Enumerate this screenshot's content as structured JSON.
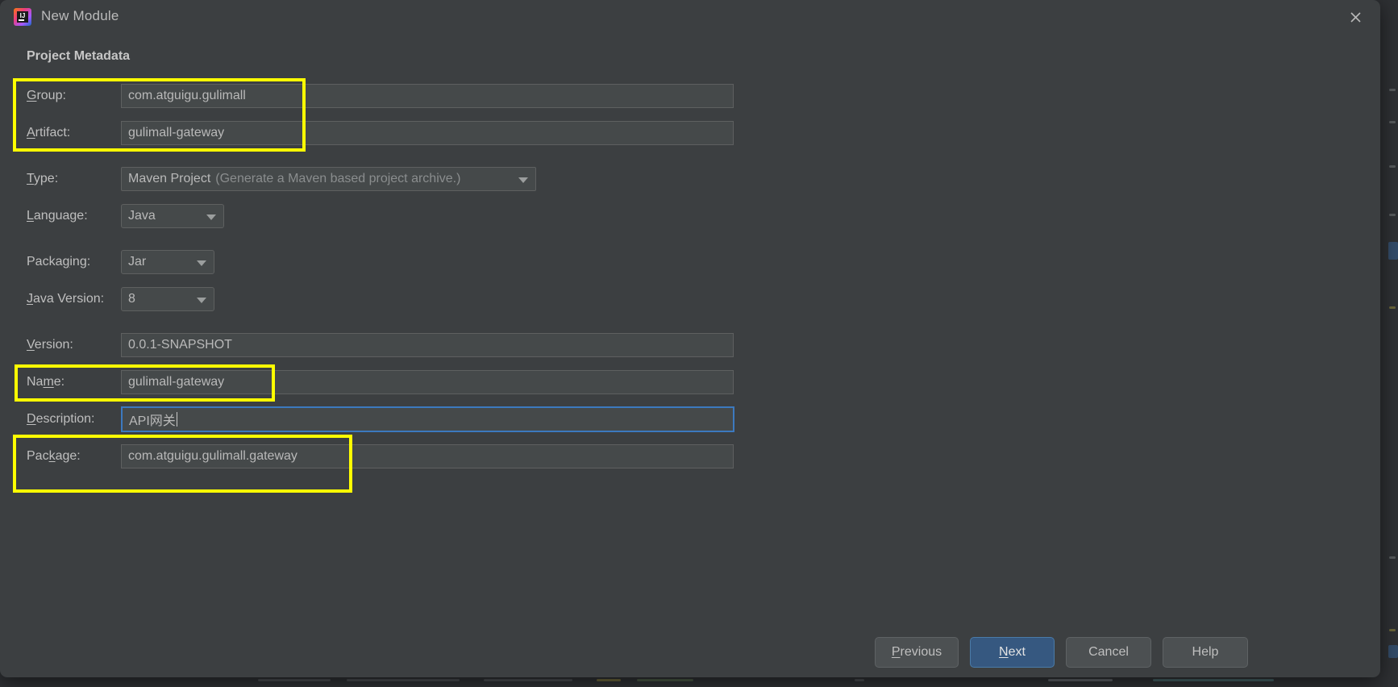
{
  "window": {
    "title": "New Module",
    "app_icon": "intellij-idea-icon",
    "close_icon": "close-icon"
  },
  "section": {
    "heading": "Project Metadata"
  },
  "form": {
    "group": {
      "label": "Group:",
      "mnemonic": "G",
      "value": "com.atguigu.gulimall"
    },
    "artifact": {
      "label": "Artifact:",
      "mnemonic": "A",
      "value": "gulimall-gateway"
    },
    "type": {
      "label": "Type:",
      "mnemonic": "T",
      "value": "Maven Project",
      "hint": "(Generate a Maven based project archive.)"
    },
    "language": {
      "label": "Language:",
      "mnemonic": "L",
      "value": "Java"
    },
    "packaging": {
      "label": "Packaging:",
      "mnemonic": "g",
      "value": "Jar"
    },
    "java_version": {
      "label": "Java Version:",
      "mnemonic": "J",
      "value": "8"
    },
    "version": {
      "label": "Version:",
      "mnemonic": "V",
      "value": "0.0.1-SNAPSHOT"
    },
    "name": {
      "label": "Name:",
      "mnemonic": "m",
      "value": "gulimall-gateway"
    },
    "description": {
      "label": "Description:",
      "mnemonic": "D",
      "value": "API网关",
      "focused": true
    },
    "package": {
      "label": "Package:",
      "mnemonic": "k",
      "value": "com.atguigu.gulimall.gateway"
    }
  },
  "buttons": {
    "previous": "Previous",
    "next": "Next",
    "cancel": "Cancel",
    "help": "Help"
  },
  "colors": {
    "dialog_bg": "#3c3f41",
    "field_bg": "#45494a",
    "accent_blue": "#365880",
    "focus_border": "#3c79bf",
    "annotation_yellow": "#ffff00",
    "text": "#bfbfbf"
  },
  "annotations": [
    {
      "name": "group-artifact-highlight"
    },
    {
      "name": "name-highlight"
    },
    {
      "name": "package-highlight"
    }
  ]
}
